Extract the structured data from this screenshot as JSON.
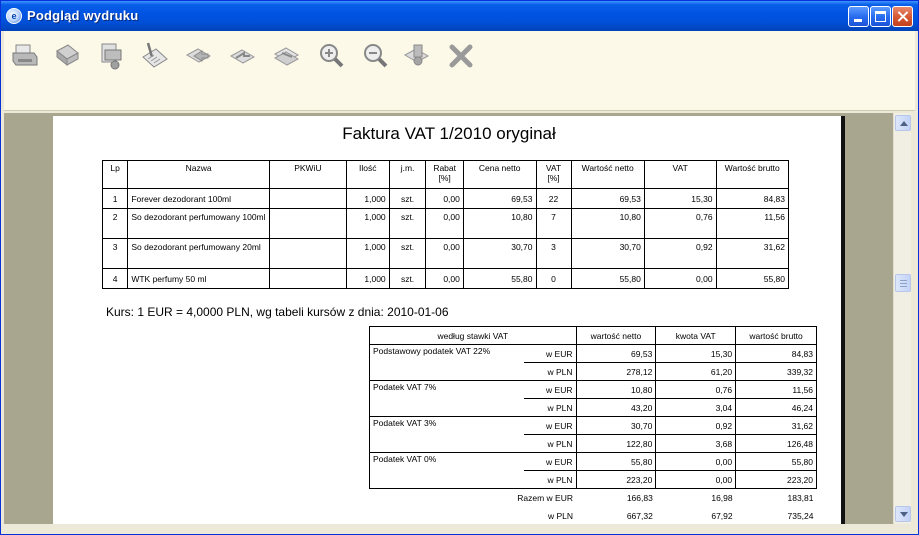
{
  "window": {
    "title": "Podgląd wydruku"
  },
  "toolbar": {
    "tools": [
      "printer-icon",
      "page-setup-icon",
      "export-icon",
      "document-edit-icon",
      "first-page-icon",
      "previous-page-icon",
      "next-page-icon",
      "zoom-in-icon",
      "zoom-out-icon",
      "settings-icon",
      "close-icon"
    ]
  },
  "document": {
    "title": "Faktura VAT  1/2010 oryginał",
    "items_headers": [
      "Lp",
      "Nazwa",
      "PKWiU",
      "Ilość",
      "j.m.",
      "Rabat\n[%]",
      "Cena netto",
      "VAT\n[%]",
      "Wartość netto",
      "VAT",
      "Wartość brutto"
    ],
    "items": [
      {
        "lp": "1",
        "name": "Forever dezodorant 100ml",
        "pkwiu": "",
        "qty": "1,000",
        "unit": "szt.",
        "discount": "0,00",
        "net_price": "69,53",
        "vat_rate": "22",
        "net_value": "69,53",
        "vat": "15,30",
        "gross": "84,83"
      },
      {
        "lp": "2",
        "name": "So dezodorant perfumowany 100ml",
        "pkwiu": "",
        "qty": "1,000",
        "unit": "szt.",
        "discount": "0,00",
        "net_price": "10,80",
        "vat_rate": "7",
        "net_value": "10,80",
        "vat": "0,76",
        "gross": "11,56"
      },
      {
        "lp": "3",
        "name": "So dezodorant perfumowany 20ml",
        "pkwiu": "",
        "qty": "1,000",
        "unit": "szt.",
        "discount": "0,00",
        "net_price": "30,70",
        "vat_rate": "3",
        "net_value": "30,70",
        "vat": "0,92",
        "gross": "31,62"
      },
      {
        "lp": "4",
        "name": "WTK perfumy 50 ml",
        "pkwiu": "",
        "qty": "1,000",
        "unit": "szt.",
        "discount": "0,00",
        "net_price": "55,80",
        "vat_rate": "0",
        "net_value": "55,80",
        "vat": "0,00",
        "gross": "55,80"
      }
    ],
    "exchange_rate": "Kurs: 1 EUR = 4,0000 PLN, wg tabeli kursów z dnia:  2010-01-06",
    "vat_headers": [
      "według stawki VAT",
      "wartość netto",
      "kwota VAT",
      "wartość brutto"
    ],
    "vat_groups": [
      {
        "label": "Podstawowy podatek VAT 22%",
        "eur": [
          "w EUR",
          "69,53",
          "15,30",
          "84,83"
        ],
        "pln": [
          "w PLN",
          "278,12",
          "61,20",
          "339,32"
        ]
      },
      {
        "label": "Podatek VAT 7%",
        "eur": [
          "w EUR",
          "10,80",
          "0,76",
          "11,56"
        ],
        "pln": [
          "w PLN",
          "43,20",
          "3,04",
          "46,24"
        ]
      },
      {
        "label": "Podatek VAT 3%",
        "eur": [
          "w EUR",
          "30,70",
          "0,92",
          "31,62"
        ],
        "pln": [
          "w PLN",
          "122,80",
          "3,68",
          "126,48"
        ]
      },
      {
        "label": "Podatek VAT 0%",
        "eur": [
          "w EUR",
          "55,80",
          "0,00",
          "55,80"
        ],
        "pln": [
          "w PLN",
          "223,20",
          "0,00",
          "223,20"
        ]
      }
    ],
    "totals": {
      "eur": [
        "Razem w EUR",
        "166,83",
        "16,98",
        "183,81"
      ],
      "pln": [
        "w PLN",
        "667,32",
        "67,92",
        "735,24"
      ]
    }
  }
}
